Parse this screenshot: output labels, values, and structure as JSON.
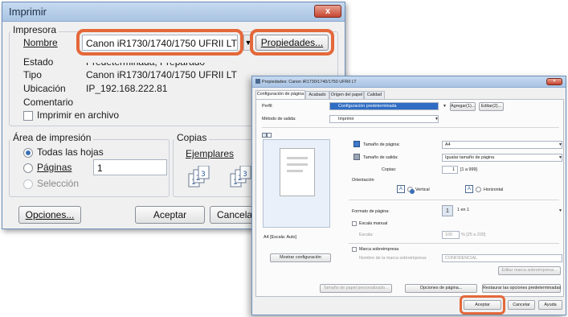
{
  "print_dialog": {
    "title": "Imprimir",
    "close": "x",
    "printer_group": "Impresora",
    "name_label_prefix": "",
    "name_label": "Nombre",
    "printer_name": "Canon iR1730/1740/1750 UFRII LT",
    "properties_button": "Propiedades...",
    "status_label": "Estado",
    "status_value": "Predeterminada; Preparado",
    "type_label": "Tipo",
    "type_value": "Canon iR1730/1740/1750 UFRII LT",
    "location_label": "Ubicación",
    "location_value": "IP_192.168.222.81",
    "comment_label": "Comentario",
    "print_to_file": "Imprimir en archivo",
    "range_group": "Área de impresión",
    "all_pages": "Todas las hojas",
    "pages": "Páginas",
    "pages_value": "1",
    "selection": "Selección",
    "copies_group": "Copias",
    "copies_label": "Ejemplares",
    "options_button": "Opciones...",
    "accept_button": "Aceptar",
    "cancel_button": "Cancelar"
  },
  "properties_dialog": {
    "title": "Propiedades: Canon iR1730/1740/1750 UFRII LT",
    "tabs": [
      "Configuración de página",
      "Acabado",
      "Origen del papel",
      "Calidad"
    ],
    "profile_label": "Perfil:",
    "profile_value": "Configuración predeterminada",
    "add_button": "Agregar(1)...",
    "edit_button": "Editar(2)...",
    "output_method_label": "Método de salida:",
    "output_method_value": "Imprimir",
    "page_size_label": "Tamaño de página:",
    "page_size_value": "A4",
    "output_size_label": "Tamaño de salida:",
    "output_size_value": "Igualar tamaño de página",
    "copies_label": "Copias:",
    "copies_value": "1",
    "copies_range": "[1 a 999]",
    "orientation_label": "Orientación",
    "vertical": "Vertical",
    "horizontal": "Horizontal",
    "preview_caption": "A4 [Escala: Auto]",
    "page_format_label": "Formato de página:",
    "page_format_value": "1 en 1",
    "manual_scale": "Escala manual",
    "scale_label": "Escala:",
    "scale_value": "100",
    "scale_range": "% [25 a 200]",
    "watermark": "Marca sobreimpresa",
    "watermark_name_label": "Nombre de la marca sobreimpresa:",
    "watermark_value": "CONFIDENCIAL",
    "show_settings": "Mostrar configuración",
    "edit_watermark": "Editar marca sobreimpresa...",
    "custom_paper": "Tamaño de papel personalizado...",
    "page_options": "Opciones de página...",
    "restore_defaults": "Restaurar las opciones predeterminadas",
    "accept": "Aceptar",
    "cancel": "Cancelar",
    "help": "Ayuda"
  },
  "colors": {
    "highlight": "#e4683a",
    "titlebar": "#a9c4e4",
    "close": "#c6452f"
  },
  "icons": [
    "printer-icon",
    "collate-icon",
    "page-preview-icon",
    "portrait-icon",
    "landscape-icon"
  ]
}
